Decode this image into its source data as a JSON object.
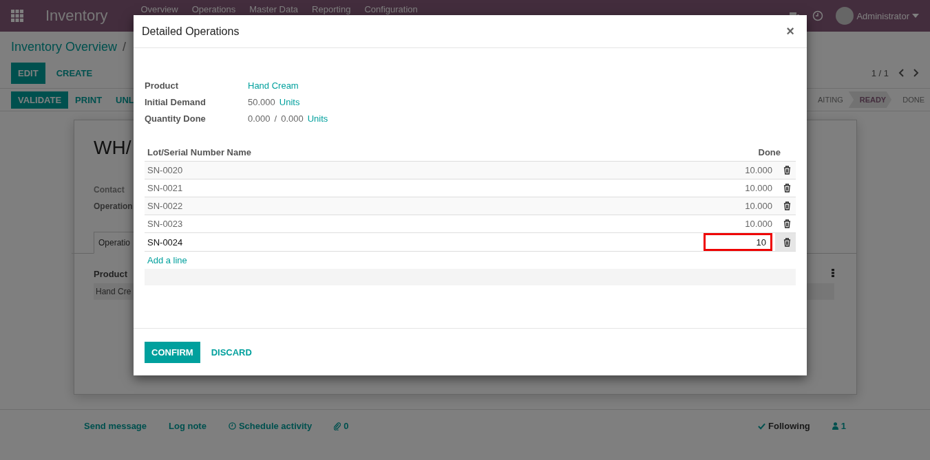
{
  "navbar": {
    "app_name": "Inventory",
    "menu": [
      "Overview",
      "Operations",
      "Master Data",
      "Reporting",
      "Configuration"
    ],
    "user": "Administrator"
  },
  "breadcrumb": [
    "Inventory Overview",
    "/"
  ],
  "buttons": [
    {
      "label": "EDIT",
      "kind": "primary"
    },
    {
      "label": "CREATE",
      "kind": "link"
    }
  ],
  "pager": "1 / 1",
  "actions": [
    {
      "label": "VALIDATE",
      "kind": "primary"
    },
    {
      "label": "PRINT",
      "kind": "link"
    },
    {
      "label": "UNL",
      "kind": "link"
    }
  ],
  "stages": [
    {
      "label": "AITING",
      "selected": false
    },
    {
      "label": "READY",
      "selected": true
    },
    {
      "label": "DONE",
      "selected": false
    }
  ],
  "sheet": {
    "title": "WH/",
    "contact_label": "Contact",
    "operation_label": "Operation",
    "tab": "Operatio",
    "column": "Product",
    "cell": "Hand Cre"
  },
  "chatter": {
    "send": "Send message",
    "log": "Log note",
    "schedule": "Schedule activity",
    "attachments": "0",
    "following": "Following",
    "followers": "1"
  },
  "dialog": {
    "title": "Detailed Operations",
    "close": "×",
    "fields": [
      {
        "label": "Product",
        "parts": [
          {
            "text": "Hand Cream",
            "kind": "link"
          }
        ]
      },
      {
        "label": "Initial Demand",
        "parts": [
          {
            "text": "50.000",
            "kind": "text"
          },
          {
            "text": "Units",
            "kind": "link"
          }
        ]
      },
      {
        "label": "Quantity Done",
        "parts": [
          {
            "text": "0.000",
            "kind": "text"
          },
          {
            "text": "/",
            "kind": "text"
          },
          {
            "text": "0.000",
            "kind": "text"
          },
          {
            "text": "Units",
            "kind": "link"
          }
        ]
      }
    ],
    "columns": [
      "Lot/Serial Number Name",
      "Done"
    ],
    "rows": [
      {
        "lot": "SN-0020",
        "done": "10.000",
        "editing": false
      },
      {
        "lot": "SN-0021",
        "done": "10.000",
        "editing": false
      },
      {
        "lot": "SN-0022",
        "done": "10.000",
        "editing": false
      },
      {
        "lot": "SN-0023",
        "done": "10.000",
        "editing": false
      },
      {
        "lot": "SN-0024",
        "done": "10",
        "editing": true
      }
    ],
    "add_line": "Add a line",
    "footer": [
      {
        "label": "CONFIRM",
        "kind": "primary"
      },
      {
        "label": "DISCARD",
        "kind": "link"
      }
    ]
  }
}
